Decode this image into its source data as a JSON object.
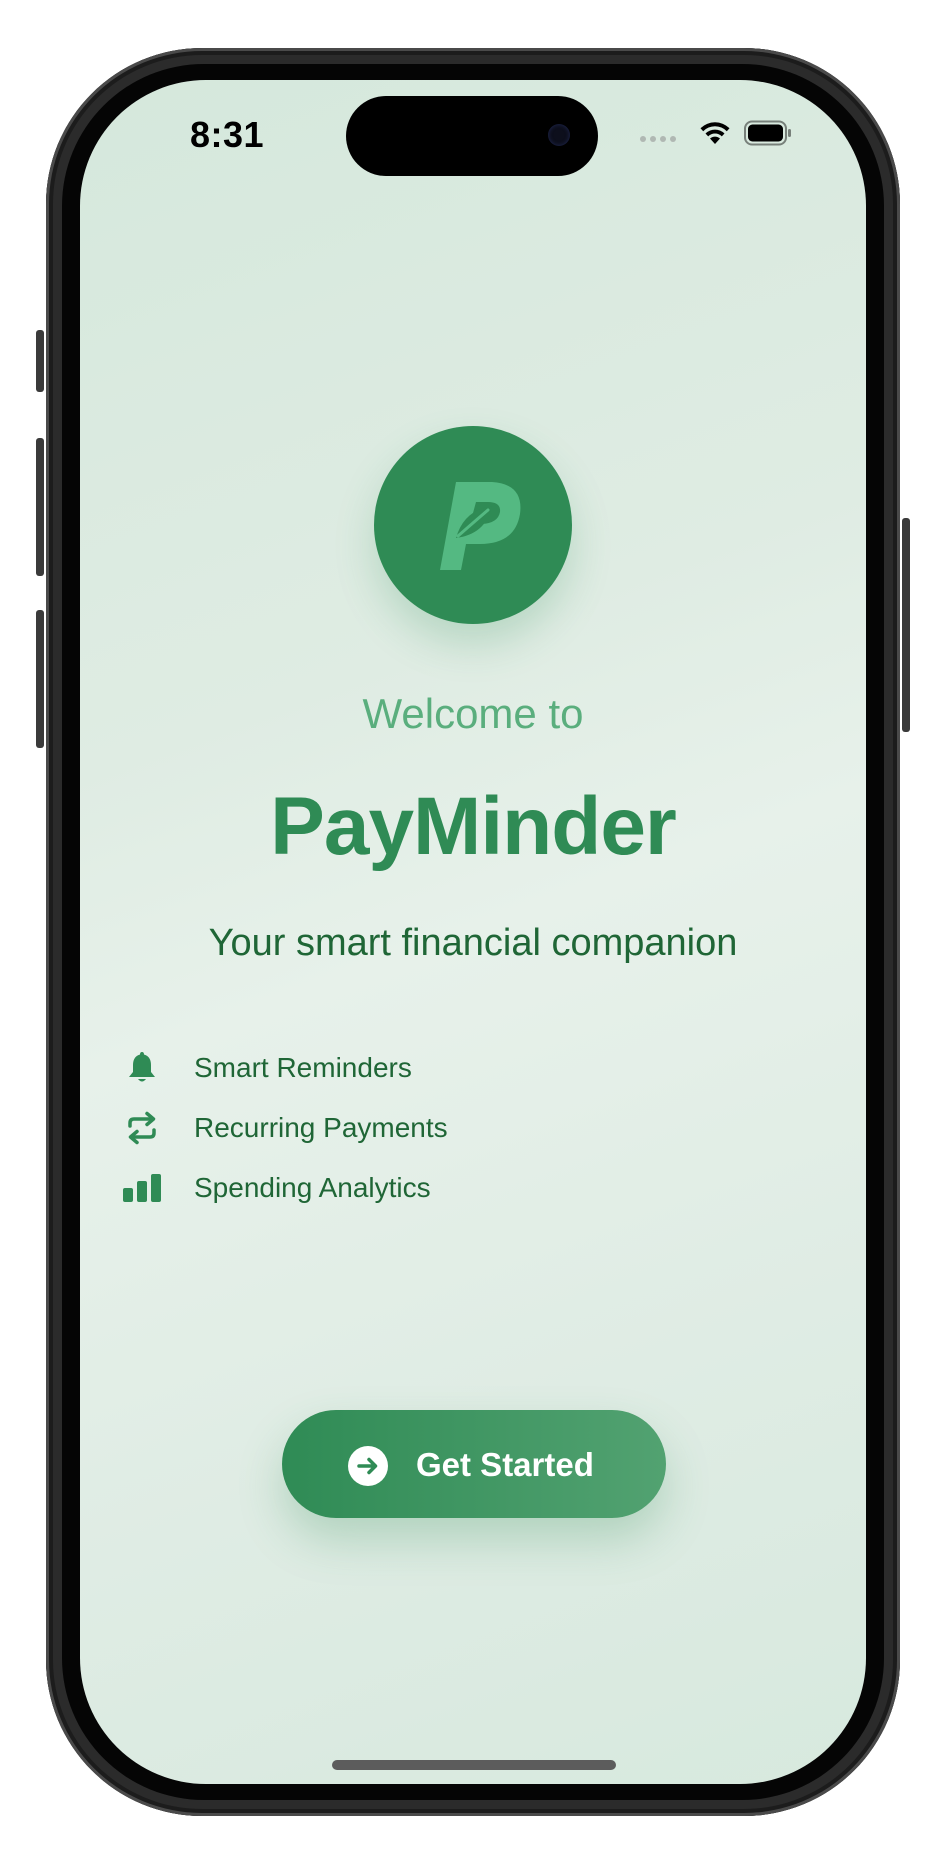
{
  "status_bar": {
    "time": "8:31",
    "icons": [
      "cellular-signal-icon",
      "wifi-icon",
      "battery-icon"
    ]
  },
  "app": {
    "logo_icon": "p-leaf-logo-icon",
    "welcome_text": "Welcome to",
    "name": "PayMinder",
    "tagline": "Your smart financial companion"
  },
  "features": [
    {
      "icon": "bell-icon",
      "label": "Smart Reminders"
    },
    {
      "icon": "repeat-icon",
      "label": "Recurring Payments"
    },
    {
      "icon": "bar-chart-icon",
      "label": "Spending Analytics"
    }
  ],
  "cta": {
    "icon": "arrow-right-circle-icon",
    "label": "Get Started"
  },
  "colors": {
    "primary": "#2f8b55",
    "primary_light": "#52a271",
    "welcome_text": "#5aae7d",
    "body_text": "#1f6636",
    "background": "#dfece3"
  }
}
